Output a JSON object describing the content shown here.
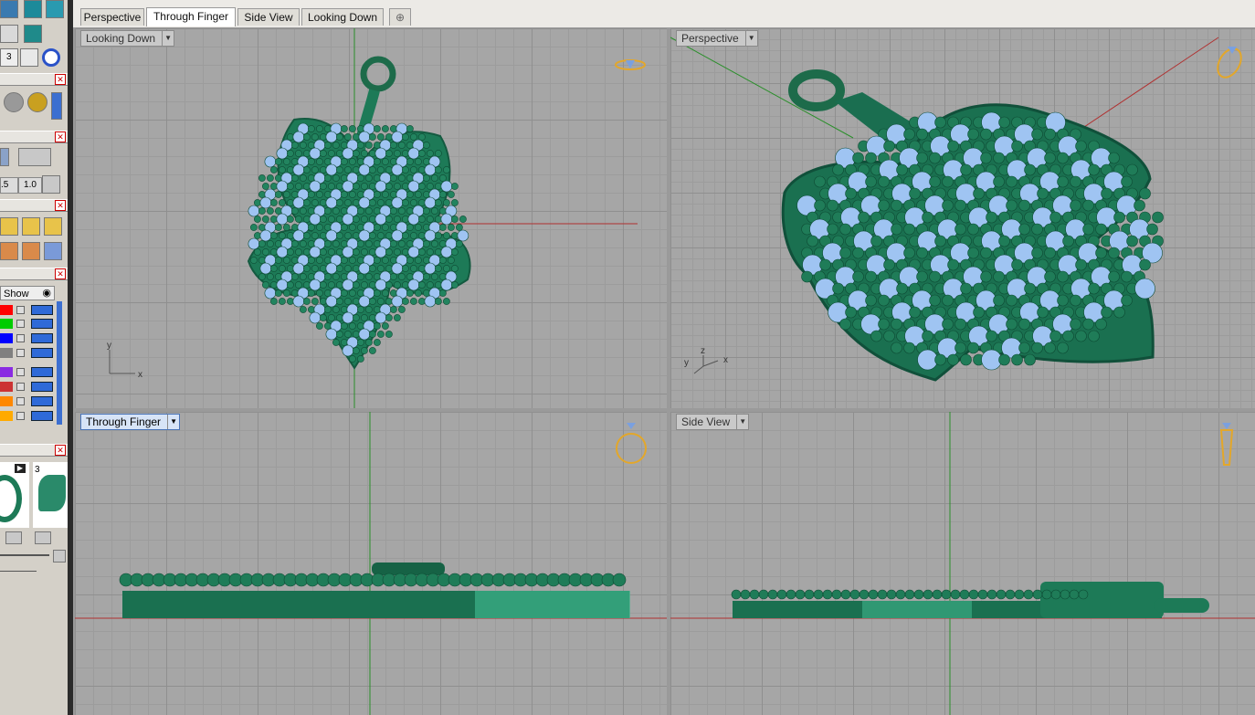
{
  "tabs": [
    {
      "label": "Perspective"
    },
    {
      "label": "Through Finger"
    },
    {
      "label": "Side View"
    },
    {
      "label": "Looking Down"
    }
  ],
  "active_tab": "Through Finger",
  "viewports": {
    "top_left": {
      "label": "Looking Down"
    },
    "top_right": {
      "label": "Perspective"
    },
    "bottom_left": {
      "label": "Through Finger"
    },
    "bottom_right": {
      "label": "Side View"
    }
  },
  "axes": {
    "x": "x",
    "y": "y",
    "z": "z"
  },
  "left_panel": {
    "toolbar_num": "3",
    "num_a": ".5",
    "num_b": "1.0",
    "layers_header": "Show",
    "layer_colors": [
      "#ff0000",
      "#00cc00",
      "#0000ff",
      "#808080",
      "#8a2be2",
      "#cc3333",
      "#ff8800",
      "#ffaa00"
    ],
    "thumb_num": "3"
  },
  "colors": {
    "model": "#1d7a57",
    "gem": "#9fc4f2",
    "axis_red": "#b03030",
    "axis_green": "#2a8f2a",
    "ring_icon": "#e3a72a"
  }
}
